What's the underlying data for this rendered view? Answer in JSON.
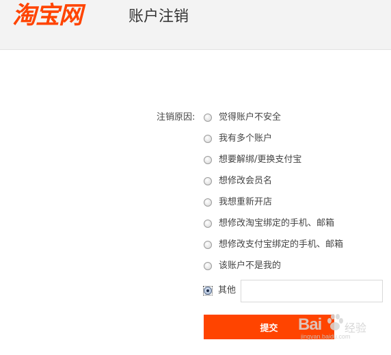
{
  "header": {
    "logo_text": "淘宝网",
    "page_title": "账户注销"
  },
  "form": {
    "reason_label": "注销原因:",
    "options": [
      {
        "label": "觉得账户不安全",
        "checked": false
      },
      {
        "label": "我有多个账户",
        "checked": false
      },
      {
        "label": "想要解绑/更换支付宝",
        "checked": false
      },
      {
        "label": "想修改会员名",
        "checked": false
      },
      {
        "label": "我想重新开店",
        "checked": false
      },
      {
        "label": "想修改淘宝绑定的手机、邮箱",
        "checked": false
      },
      {
        "label": "想修改支付宝绑定的手机、邮箱",
        "checked": false
      },
      {
        "label": "该账户不是我的",
        "checked": false
      },
      {
        "label": "其他",
        "checked": true
      }
    ],
    "other_value": "",
    "submit_label": "提交"
  },
  "watermark": {
    "brand": "Bai",
    "brand_suffix": "经验",
    "url": "jingyan.baidu.com"
  },
  "colors": {
    "accent": "#ff4400",
    "header_bg": "#f3f3f3"
  }
}
